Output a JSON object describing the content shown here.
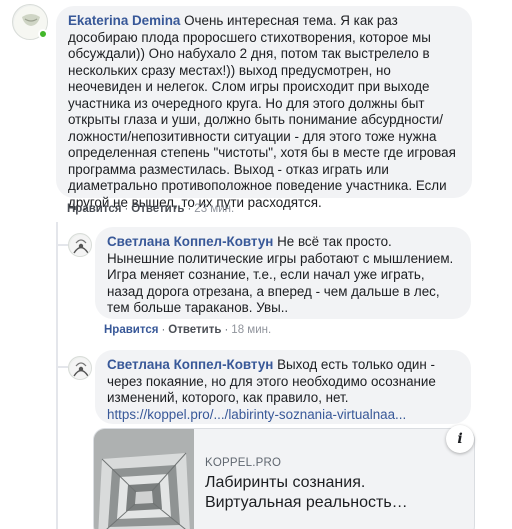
{
  "comments": [
    {
      "author": "Ekaterina Demina",
      "text": "Очень интересная тема. Я как раз дособираю плода проросшего стихотворения, которое мы обсуждали)) Оно набухало 2 дня, потом так выстрелело в нескольких сразу местах!)) выход предусмотрен, но неочевиден и нелегок. Слом игры происходит при выходе участника из очередного круга. Но для этого должны быт открыты глаза и уши, должно быть понимание абсурдности/ложности/непозитивности ситуации - для этого тоже нужна определенная степень \"чистоты\", хотя бы в месте где игровая программа разместилась. Выход - отказ играть или диаметрально противоположное поведение участника. Если другой не вышел, то их пути расходятся.",
      "like": "Нравится",
      "reply": "Ответить",
      "time": "23 мин."
    },
    {
      "author": "Светлана Коппел-Ковтун",
      "text": "Не всё так просто. Нынешние политические игры работают с мышлением. Игра меняет сознание, т.е., если начал уже играть, назад дорога отрезана, а вперед - чем дальше в лес, тем больше тараканов. Увы..",
      "like": "Нравится",
      "reply": "Ответить",
      "time": "18 мин."
    },
    {
      "author": "Светлана Коппел-Ковтун",
      "text": "Выход есть только один - через покаяние, но для этого необходимо осознание изменений, которого, как правило, нет.",
      "link": "https://koppel.pro/.../labirinty-soznania-virtualnaa..."
    }
  ],
  "separator": "·",
  "link_preview": {
    "domain": "KOPPEL.PRO",
    "title": "Лабиринты сознания. Виртуальная реальность…",
    "info_icon": "info-icon"
  },
  "colors": {
    "author": "#385898",
    "bubble": "#f2f3f5",
    "online": "#42b72a"
  }
}
